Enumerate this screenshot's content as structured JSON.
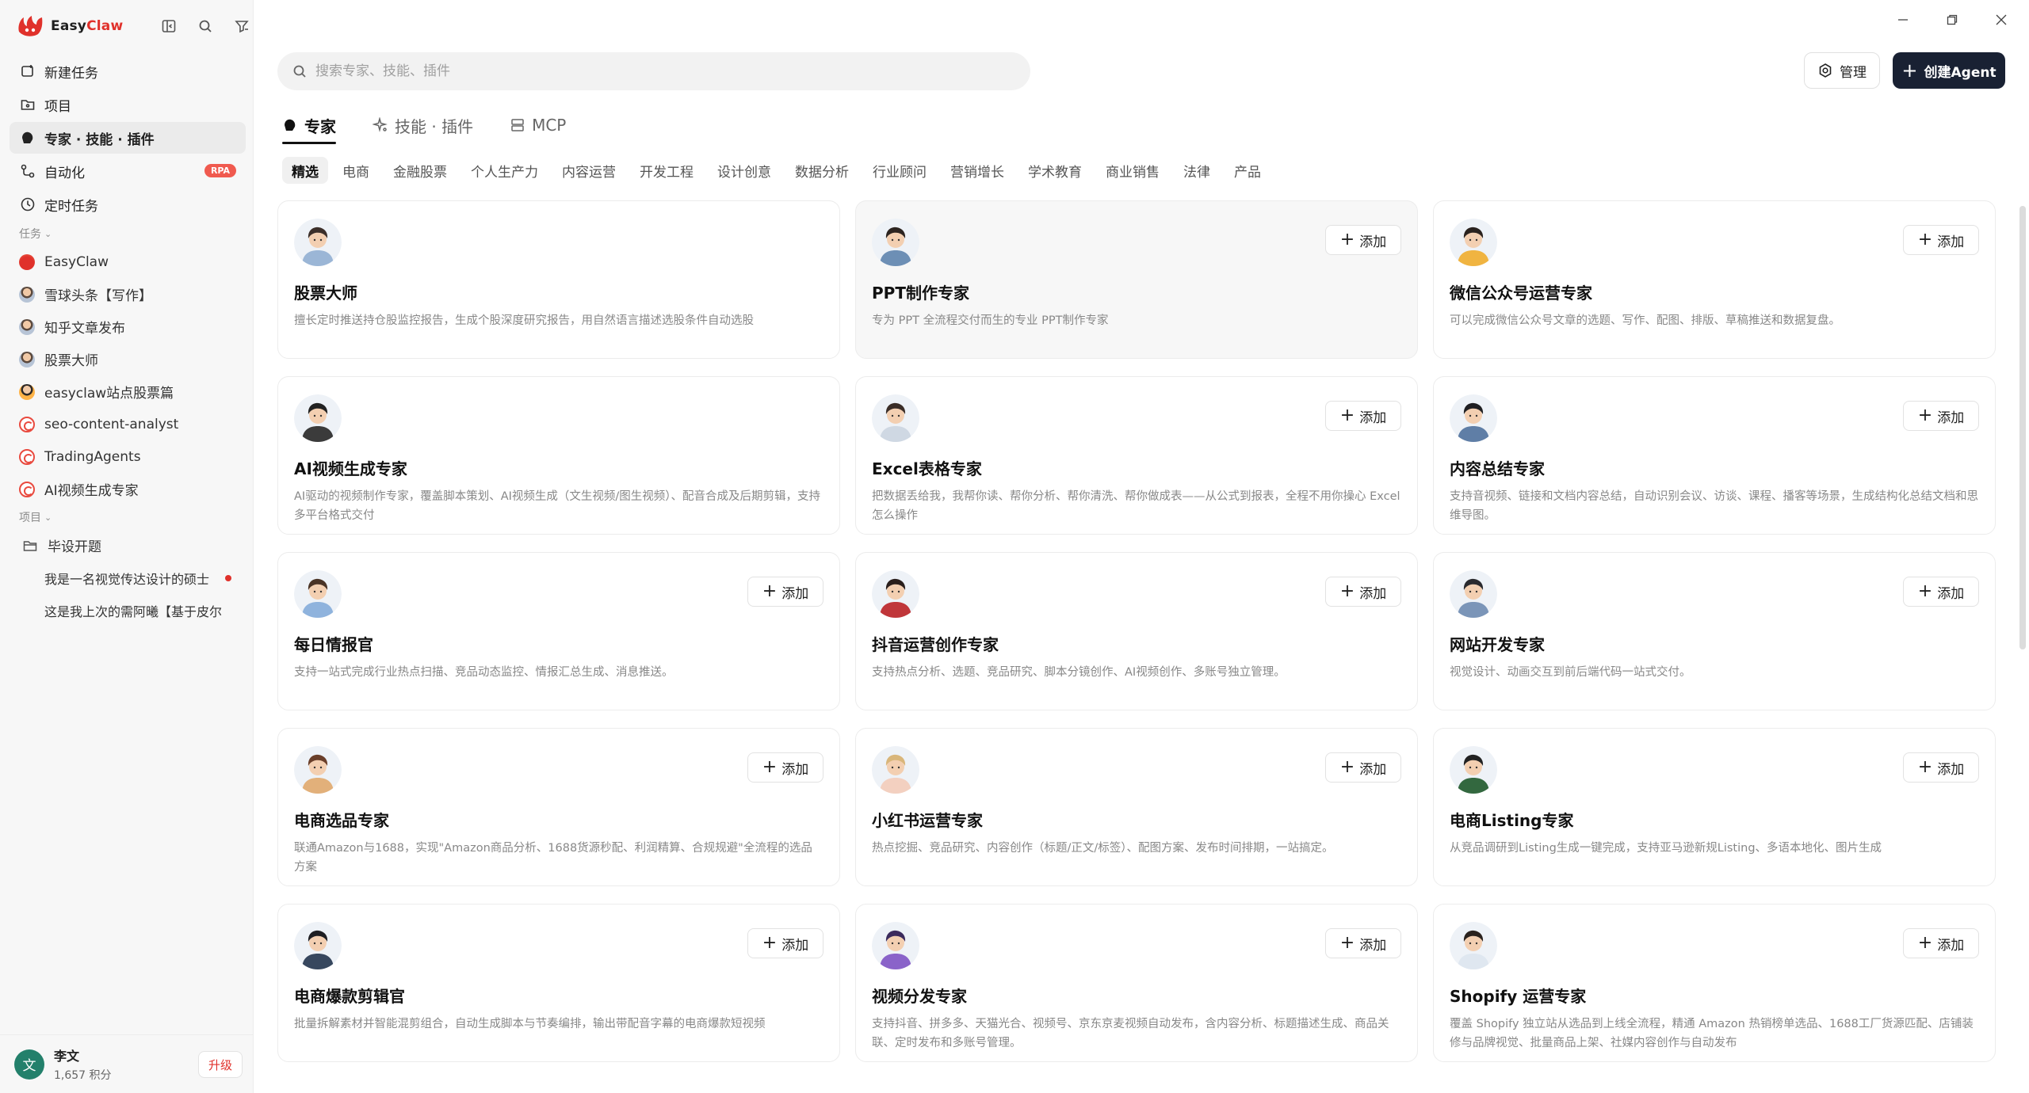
{
  "app": {
    "name_easy": "Easy",
    "name_claw": "Claw"
  },
  "sidebar": {
    "nav": [
      {
        "label": "新建任务",
        "icon": "new-task-icon"
      },
      {
        "label": "项目",
        "icon": "folder-icon"
      },
      {
        "label": "专家 · 技能 · 插件",
        "icon": "expert-icon",
        "active": true
      },
      {
        "label": "自动化",
        "icon": "automation-icon",
        "badge": "RPA"
      },
      {
        "label": "定时任务",
        "icon": "clock-icon"
      }
    ],
    "tasks_label": "任务",
    "tasks": [
      {
        "label": "EasyClaw",
        "avatar": "claw"
      },
      {
        "label": "雪球头条【写作】",
        "avatar": "person"
      },
      {
        "label": "知乎文章发布",
        "avatar": "person"
      },
      {
        "label": "股票大师",
        "avatar": "person"
      },
      {
        "label": "easyclaw站点股票篇",
        "avatar": "person2"
      },
      {
        "label": "seo-content-analyst",
        "avatar": "red"
      },
      {
        "label": "TradingAgents",
        "avatar": "red"
      },
      {
        "label": "AI视频生成专家",
        "avatar": "red"
      }
    ],
    "projects_label": "项目",
    "project_folder": "毕设开题",
    "project_items": [
      {
        "label": "我是一名视觉传达设计的硕士",
        "unread": true
      },
      {
        "label": "这是我上次的需阿曦【基于皮尔",
        "unread": false
      }
    ],
    "user": {
      "initial": "文",
      "name": "李文",
      "points": "1,657 积分",
      "upgrade": "升级"
    }
  },
  "header": {
    "search_placeholder": "搜索专家、技能、插件",
    "manage": "管理",
    "create": "创建Agent"
  },
  "tabs": [
    {
      "label": "专家",
      "active": true
    },
    {
      "label": "技能 · 插件"
    },
    {
      "label": "MCP"
    }
  ],
  "categories": [
    "精选",
    "电商",
    "金融股票",
    "个人生产力",
    "内容运营",
    "开发工程",
    "设计创意",
    "数据分析",
    "行业顾问",
    "营销增长",
    "学术教育",
    "商业销售",
    "法律",
    "产品"
  ],
  "add_label": "添加",
  "cards": [
    {
      "title": "股票大师",
      "desc": "擅长定时推送持仓股监控报告，生成个股深度研究报告，用自然语言描述选股条件自动选股",
      "has_add": false,
      "hair": "#3b2f2a",
      "shirt": "#9bb6d6"
    },
    {
      "title": "PPT制作专家",
      "desc": "专为 PPT 全流程交付而生的专业 PPT制作专家",
      "has_add": true,
      "hover": true,
      "hair": "#2c2420",
      "shirt": "#6d8fb5"
    },
    {
      "title": "微信公众号运营专家",
      "desc": "可以完成微信公众号文章的选题、写作、配图、排版、草稿推送和数据复盘。",
      "has_add": true,
      "hair": "#2a221e",
      "shirt": "#f0b441"
    },
    {
      "title": "AI视频生成专家",
      "desc": "AI驱动的视频制作专家，覆盖脚本策划、AI视频生成（文生视频/图生视频）、配音合成及后期剪辑，支持多平台格式交付",
      "has_add": false,
      "hair": "#222",
      "shirt": "#3b3b3b"
    },
    {
      "title": "Excel表格专家",
      "desc": "把数据丢给我，我帮你读、帮你分析、帮你清洗、帮你做成表——从公式到报表，全程不用你操心 Excel 怎么操作",
      "has_add": true,
      "hair": "#3a2d27",
      "shirt": "#cfd8e3"
    },
    {
      "title": "内容总结专家",
      "desc": "支持音视频、链接和文档内容总结，自动识别会议、访谈、课程、播客等场景，生成结构化总结文档和思维导图。",
      "has_add": true,
      "hair": "#1f1f22",
      "shirt": "#5f7ea6"
    },
    {
      "title": "每日情报官",
      "desc": "支持一站式完成行业热点扫描、竞品动态监控、情报汇总生成、消息推送。",
      "has_add": true,
      "hair": "#4a3426",
      "shirt": "#8fb3dd"
    },
    {
      "title": "抖音运营创作专家",
      "desc": "支持热点分析、选题、竞品研究、脚本分镜创作、AI视频创作、多账号独立管理。",
      "has_add": true,
      "hair": "#2a1f1c",
      "shirt": "#c0363a"
    },
    {
      "title": "网站开发专家",
      "desc": "视觉设计、动画交互到前后端代码一站式交付。",
      "has_add": true,
      "hair": "#2a2a2e",
      "shirt": "#7b95b8"
    },
    {
      "title": "电商选品专家",
      "desc": "联通Amazon与1688，实现\"Amazon商品分析、1688货源秒配、利润精算、合规规避\"全流程的选品方案",
      "has_add": true,
      "hair": "#6a3f2a",
      "shirt": "#e2b07a"
    },
    {
      "title": "小红书运营专家",
      "desc": "热点挖掘、竞品研究、内容创作（标题/正文/标签）、配图方案、发布时间排期，一站搞定。",
      "has_add": true,
      "hair": "#d9b67a",
      "shirt": "#f3d0c0"
    },
    {
      "title": "电商Listing专家",
      "desc": "从竞品调研到Listing生成一键完成，支持亚马逊新规Listing、多语本地化、图片生成",
      "has_add": true,
      "hair": "#222",
      "shirt": "#33683f"
    },
    {
      "title": "电商爆款剪辑官",
      "desc": "批量拆解素材并智能混剪组合，自动生成脚本与节奏编排，输出带配音字幕的电商爆款短视频",
      "has_add": true,
      "hair": "#1e1e22",
      "shirt": "#37475e"
    },
    {
      "title": "视频分发专家",
      "desc": "支持抖音、拼多多、天猫光合、视频号、京东京麦视频自动发布，含内容分析、标题描述生成、商品关联、定时发布和多账号管理。",
      "has_add": true,
      "hair": "#3b2a5c",
      "shirt": "#8a63c9"
    },
    {
      "title": "Shopify 运营专家",
      "desc": "覆盖 Shopify 独立站从选品到上线全流程，精通 Amazon 热销榜单选品、1688工厂货源匹配、店铺装修与品牌视觉、批量商品上架、社媒内容创作与自动发布",
      "has_add": true,
      "hair": "#2a221e",
      "shirt": "#dfe7f0"
    }
  ]
}
